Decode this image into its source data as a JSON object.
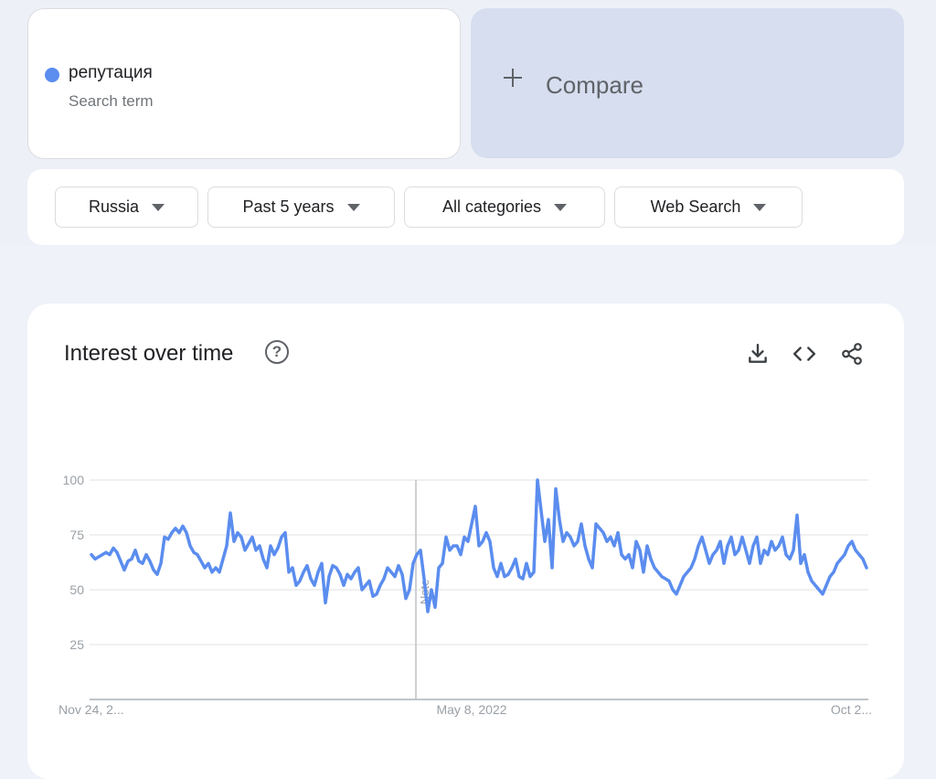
{
  "search_term": {
    "name": "репутация",
    "type": "Search term",
    "color": "#5b8def"
  },
  "compare": {
    "label": "Compare"
  },
  "filters": [
    {
      "label": "Russia"
    },
    {
      "label": "Past 5 years"
    },
    {
      "label": "All categories"
    },
    {
      "label": "Web Search"
    }
  ],
  "chart": {
    "title": "Interest over time",
    "actions": [
      "download-icon",
      "embed-code-icon",
      "share-icon"
    ],
    "note_label": "Note"
  },
  "chart_data": {
    "type": "line",
    "title": "Interest over time",
    "xlabel": "",
    "ylabel": "",
    "ylim": [
      0,
      100
    ],
    "y_ticks": [
      25,
      50,
      75,
      100
    ],
    "x_tick_labels": [
      "Nov 24, 2...",
      "May 8, 2022",
      "Oct 2..."
    ],
    "grid": true,
    "legend": "none",
    "series": [
      {
        "color": "#5b8def",
        "values": [
          66,
          64,
          65,
          66,
          67,
          66,
          69,
          67,
          63,
          59,
          63,
          64,
          68,
          63,
          62,
          66,
          63,
          59,
          57,
          62,
          74,
          73,
          76,
          78,
          76,
          79,
          76,
          70,
          67,
          66,
          63,
          60,
          62,
          58,
          60,
          58,
          64,
          70,
          85,
          72,
          76,
          74,
          68,
          71,
          74,
          68,
          70,
          64,
          60,
          70,
          66,
          69,
          74,
          76,
          58,
          60,
          52,
          54,
          58,
          61,
          55,
          52,
          58,
          62,
          44,
          56,
          61,
          60,
          57,
          52,
          57,
          55,
          58,
          60,
          50,
          52,
          54,
          47,
          48,
          52,
          55,
          60,
          58,
          56,
          61,
          57,
          46,
          50,
          62,
          66,
          68,
          55,
          40,
          50,
          42,
          60,
          62,
          74,
          68,
          70,
          70,
          66,
          74,
          72,
          80,
          88,
          70,
          72,
          76,
          72,
          60,
          56,
          62,
          56,
          57,
          60,
          64,
          56,
          55,
          62,
          56,
          58,
          100,
          86,
          72,
          82,
          60,
          96,
          82,
          72,
          76,
          74,
          70,
          72,
          80,
          70,
          64,
          60,
          80,
          78,
          76,
          72,
          74,
          70,
          76,
          66,
          64,
          66,
          60,
          72,
          68,
          58,
          70,
          64,
          60,
          58,
          56,
          55,
          54,
          50,
          48,
          52,
          56,
          58,
          60,
          64,
          70,
          74,
          68,
          62,
          66,
          68,
          72,
          62,
          70,
          74,
          66,
          68,
          74,
          68,
          62,
          70,
          74,
          62,
          68,
          66,
          72,
          68,
          70,
          74,
          66,
          64,
          68,
          84,
          62,
          66,
          58,
          54,
          52,
          50,
          48,
          52,
          56,
          58,
          62,
          64,
          66,
          70,
          72,
          68,
          66,
          64,
          60
        ]
      }
    ]
  }
}
